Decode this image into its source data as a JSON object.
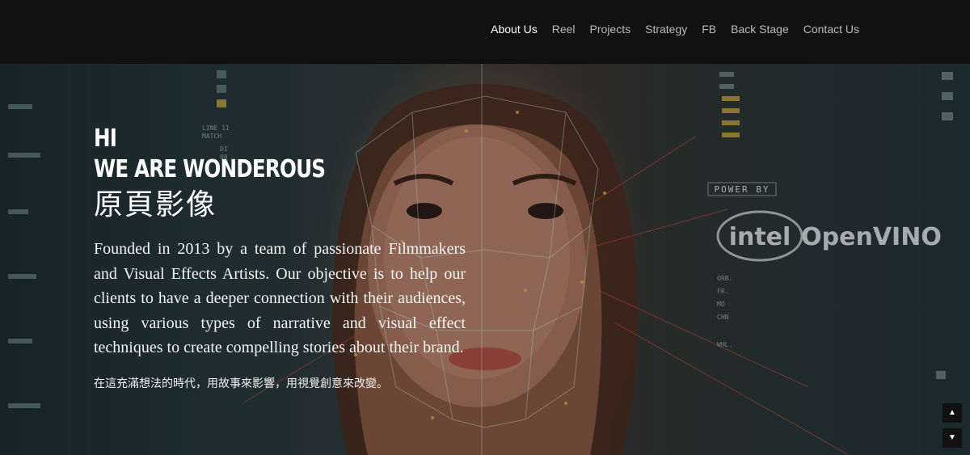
{
  "nav": {
    "items": [
      {
        "label": "About Us",
        "active": true
      },
      {
        "label": "Reel"
      },
      {
        "label": "Projects"
      },
      {
        "label": "Strategy"
      },
      {
        "label": "FB"
      },
      {
        "label": "Back Stage"
      },
      {
        "label": "Contact Us"
      }
    ]
  },
  "hero": {
    "hi": "HI",
    "headline": "WE ARE WONDEROUS",
    "chinese_title": "原頁影像",
    "paragraph": "Founded in 2013 by a team of passionate Filmmakers and Visual Effects Artists. Our objective is to help our clients to have a deeper connection with their audiences, using various types of narrative and visual effect techniques to create compelling stories about their brand.",
    "chinese_sub": "在這充滿想法的時代，用故事來影響，用視覺創意來改變。"
  },
  "overlay": {
    "power_by": "POWER BY",
    "intel": "intel",
    "openvino": "OpenVINO",
    "hud_left": [
      "LINE 11",
      "MATCH"
    ],
    "hud_left2": [
      "DI",
      "00"
    ],
    "hud_right": [
      "ORB.",
      "FR.",
      "MO",
      "CHN",
      "WHL."
    ]
  },
  "scroll": {
    "up_icon": "caret-up-icon",
    "down_icon": "caret-down-icon"
  }
}
